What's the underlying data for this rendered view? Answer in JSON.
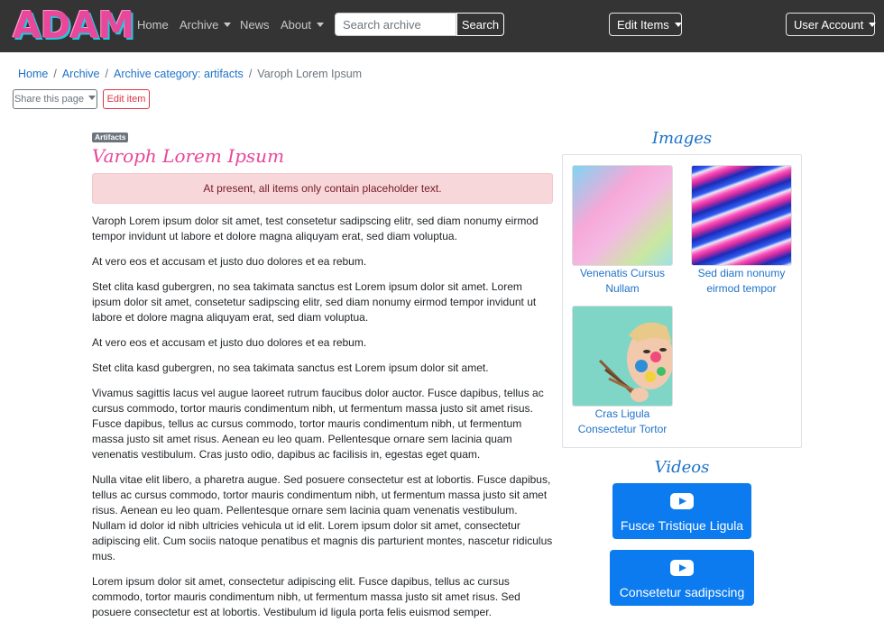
{
  "navbar": {
    "logo": "ADAM",
    "links": [
      {
        "label": "Home"
      },
      {
        "label": "Archive"
      },
      {
        "label": "News"
      },
      {
        "label": "About"
      }
    ],
    "search": {
      "placeholder": "Search archive",
      "button": "Search"
    },
    "edit_items": "Edit Items",
    "user_account": "User Account"
  },
  "breadcrumb": [
    "Home",
    "Archive",
    "Archive category: artifacts",
    "Varoph Lorem Ipsum"
  ],
  "actions": {
    "share": "Share this page",
    "edit": "Edit item"
  },
  "item": {
    "badge": "Artifacts",
    "title": "Varoph Lorem Ipsum",
    "alert": "At present, all items only contain placeholder text.",
    "paragraphs": [
      "Varoph Lorem ipsum dolor sit amet, test consetetur sadipscing elitr, sed diam nonumy eirmod tempor invidunt ut labore et dolore magna aliquyam erat, sed diam voluptua.",
      "At vero eos et accusam et justo duo dolores et ea rebum.",
      "Stet clita kasd gubergren, no sea takimata sanctus est Lorem ipsum dolor sit amet. Lorem ipsum dolor sit amet, consetetur sadipscing elitr, sed diam nonumy eirmod tempor invidunt ut labore et dolore magna aliquyam erat, sed diam voluptua.",
      "At vero eos et accusam et justo duo dolores et ea rebum.",
      "Stet clita kasd gubergren, no sea takimata sanctus est Lorem ipsum dolor sit amet.",
      "Vivamus sagittis lacus vel augue laoreet rutrum faucibus dolor auctor. Fusce dapibus, tellus ac cursus commodo, tortor mauris condimentum nibh, ut fermentum massa justo sit amet risus. Fusce dapibus, tellus ac cursus commodo, tortor mauris condimentum nibh, ut fermentum massa justo sit amet risus. Aenean eu leo quam. Pellentesque ornare sem lacinia quam venenatis vestibulum. Cras justo odio, dapibus ac facilisis in, egestas eget quam.",
      "Nulla vitae elit libero, a pharetra augue. Sed posuere consectetur est at lobortis. Fusce dapibus, tellus ac cursus commodo, tortor mauris condimentum nibh, ut fermentum massa justo sit amet risus. Aenean eu leo quam. Pellentesque ornare sem lacinia quam venenatis vestibulum. Nullam id dolor id nibh ultricies vehicula ut id elit. Lorem ipsum dolor sit amet, consectetur adipiscing elit. Cum sociis natoque penatibus et magnis dis parturient montes, nascetur ridiculus mus.",
      "Lorem ipsum dolor sit amet, consectetur adipiscing elit. Fusce dapibus, tellus ac cursus commodo, tortor mauris condimentum nibh, ut fermentum massa justo sit amet risus. Sed posuere consectetur est at lobortis. Vestibulum id ligula porta felis euismod semper."
    ]
  },
  "images": {
    "title": "Images",
    "items": [
      {
        "caption_line1": "Venenatis Cursus",
        "caption_line2": "Nullam"
      },
      {
        "caption_line1": "Sed diam nonumy",
        "caption_line2": "eirmod tempor"
      },
      {
        "caption_line1": "Cras Ligula",
        "caption_line2": "Consectetur Tortor"
      }
    ]
  },
  "videos": {
    "title": "Videos",
    "items": [
      {
        "label": "Fusce Tristique Ligula",
        "icon": "youtube-play-icon"
      },
      {
        "label": "Consetetur sadipscing",
        "icon": "youtube-play-icon"
      }
    ]
  },
  "colors": {
    "navbar_bg": "#343434",
    "link": "#1e72c8",
    "title_pink": "#e8479a",
    "alert_bg": "#f8d7da",
    "video_button": "#0d7bf0",
    "danger": "#dc3545"
  }
}
